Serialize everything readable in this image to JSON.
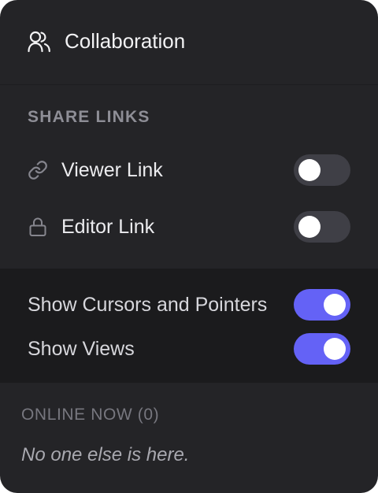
{
  "header": {
    "icon": "users-icon",
    "title": "Collaboration"
  },
  "share_links": {
    "section_label": "SHARE LINKS",
    "items": [
      {
        "icon": "link-icon",
        "label": "Viewer Link",
        "enabled": false
      },
      {
        "icon": "lock-icon",
        "label": "Editor Link",
        "enabled": false
      }
    ]
  },
  "display_options": {
    "items": [
      {
        "label": "Show Cursors and Pointers",
        "enabled": true
      },
      {
        "label": "Show Views",
        "enabled": true
      }
    ]
  },
  "online": {
    "label": "ONLINE NOW (0)",
    "empty_message": "No one else is here."
  },
  "colors": {
    "panel_background": "#242427",
    "display_background": "#1b1b1d",
    "toggle_on": "#6462f6",
    "toggle_off": "#3f3f46"
  }
}
